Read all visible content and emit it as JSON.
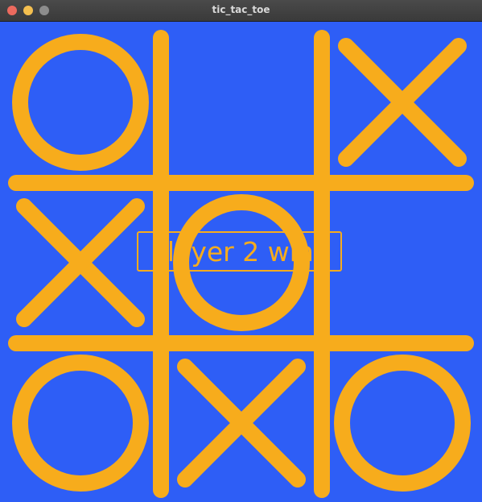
{
  "window": {
    "title": "tic_tac_toe"
  },
  "colors": {
    "background": "#2e5ef6",
    "mark": "#f7ac1c",
    "titlebar": "#3c3c3c"
  },
  "board": {
    "cells": [
      [
        "O",
        "",
        "X"
      ],
      [
        "X",
        "O",
        ""
      ],
      [
        "O",
        "X",
        "O"
      ]
    ]
  },
  "status": {
    "message": "Player 2 wins"
  }
}
